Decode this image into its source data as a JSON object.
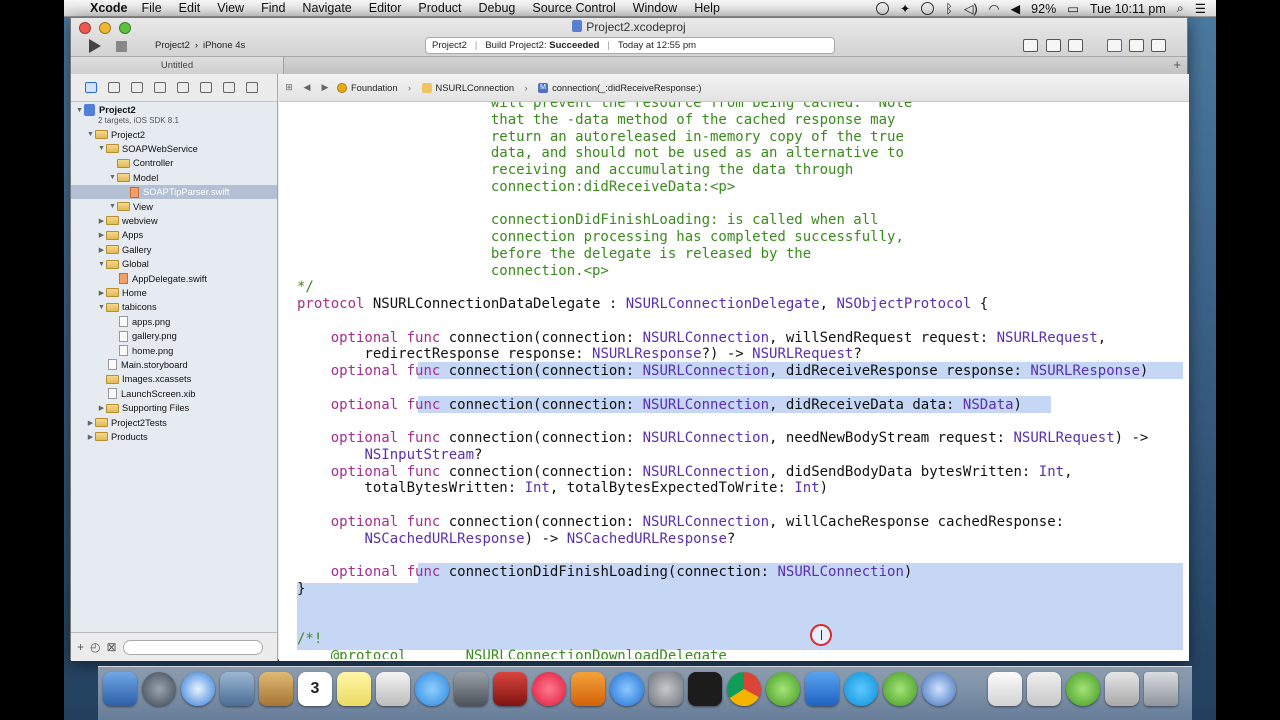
{
  "menubar": {
    "app": "Xcode",
    "items": [
      "File",
      "Edit",
      "View",
      "Find",
      "Navigate",
      "Editor",
      "Product",
      "Debug",
      "Source Control",
      "Window",
      "Help"
    ],
    "battery": "92%",
    "clock": "Tue 10:11 pm"
  },
  "window": {
    "title": "Project2.xcodeproj",
    "scheme": "Project2",
    "device": "iPhone 4s",
    "status": {
      "project": "Project2",
      "build_prefix": "Build Project2:",
      "build_result": "Succeeded",
      "time": "Today at 12:55 pm"
    },
    "tab": "Untitled"
  },
  "navigator": {
    "project_sub": "2 targets, iOS SDK 8.1",
    "items": [
      {
        "label": "Project2",
        "indent": 0,
        "kind": "project",
        "open": true
      },
      {
        "label": "Project2",
        "indent": 1,
        "kind": "folder",
        "open": true
      },
      {
        "label": "SOAPWebService",
        "indent": 2,
        "kind": "folder",
        "open": true
      },
      {
        "label": "Controller",
        "indent": 3,
        "kind": "folder",
        "open": null
      },
      {
        "label": "Model",
        "indent": 3,
        "kind": "folder",
        "open": true
      },
      {
        "label": "SOAPTipParser.swift",
        "indent": 4,
        "kind": "swift",
        "open": null,
        "selected": true
      },
      {
        "label": "View",
        "indent": 3,
        "kind": "folder",
        "open": true
      },
      {
        "label": "webview",
        "indent": 2,
        "kind": "folder",
        "open": false
      },
      {
        "label": "Apps",
        "indent": 2,
        "kind": "folder",
        "open": false
      },
      {
        "label": "Gallery",
        "indent": 2,
        "kind": "folder",
        "open": false
      },
      {
        "label": "Global",
        "indent": 2,
        "kind": "folder",
        "open": true
      },
      {
        "label": "AppDelegate.swift",
        "indent": 3,
        "kind": "swift",
        "open": null
      },
      {
        "label": "Home",
        "indent": 2,
        "kind": "folder",
        "open": false
      },
      {
        "label": "tabicons",
        "indent": 2,
        "kind": "folder",
        "open": true
      },
      {
        "label": "apps.png",
        "indent": 3,
        "kind": "file",
        "open": null
      },
      {
        "label": "gallery.png",
        "indent": 3,
        "kind": "file",
        "open": null
      },
      {
        "label": "home.png",
        "indent": 3,
        "kind": "file",
        "open": null
      },
      {
        "label": "Main.storyboard",
        "indent": 2,
        "kind": "file",
        "open": null
      },
      {
        "label": "Images.xcassets",
        "indent": 2,
        "kind": "folder",
        "open": null
      },
      {
        "label": "LaunchScreen.xib",
        "indent": 2,
        "kind": "file",
        "open": null
      },
      {
        "label": "Supporting Files",
        "indent": 2,
        "kind": "folder",
        "open": false
      },
      {
        "label": "Project2Tests",
        "indent": 1,
        "kind": "folder",
        "open": false
      },
      {
        "label": "Products",
        "indent": 1,
        "kind": "folder",
        "open": false
      }
    ],
    "add_label": "+"
  },
  "jumpbar": {
    "crumbs": [
      "Foundation",
      "NSURLConnection",
      "connection(_:didReceiveResponse:)"
    ]
  },
  "code": [
    [
      [
        "cm",
        "                       will prevent the resource from being cached.  Note"
      ]
    ],
    [
      [
        "cm",
        "                       that the -data method of the cached response may"
      ]
    ],
    [
      [
        "cm",
        "                       return an autoreleased in-memory copy of the true"
      ]
    ],
    [
      [
        "cm",
        "                       data, and should not be used as an alternative to"
      ]
    ],
    [
      [
        "cm",
        "                       receiving and accumulating the data through"
      ]
    ],
    [
      [
        "cm",
        "                       connection:didReceiveData:<p>"
      ]
    ],
    [
      [
        "",
        ""
      ]
    ],
    [
      [
        "cm",
        "                       connectionDidFinishLoading: is called when all"
      ]
    ],
    [
      [
        "cm",
        "                       connection processing has completed successfully,"
      ]
    ],
    [
      [
        "cm",
        "                       before the delegate is released by the"
      ]
    ],
    [
      [
        "cm",
        "                       connection.<p>"
      ]
    ],
    [
      [
        "cm",
        "*/"
      ]
    ],
    [
      [
        "kw",
        "protocol"
      ],
      [
        "",
        " NSURLConnectionDataDelegate : "
      ],
      [
        "ty",
        "NSURLConnectionDelegate"
      ],
      [
        "",
        ", "
      ],
      [
        "ty",
        "NSObjectProtocol"
      ],
      [
        "",
        " {"
      ]
    ],
    [
      [
        "",
        ""
      ]
    ],
    [
      [
        "",
        "    "
      ],
      [
        "kw",
        "optional"
      ],
      [
        "",
        " "
      ],
      [
        "kw",
        "func"
      ],
      [
        "",
        " connection(connection: "
      ],
      [
        "ty",
        "NSURLConnection"
      ],
      [
        "",
        ", willSendRequest request: "
      ],
      [
        "ty",
        "NSURLRequest"
      ],
      [
        "",
        ","
      ]
    ],
    [
      [
        "",
        "        redirectResponse response: "
      ],
      [
        "ty",
        "NSURLResponse"
      ],
      [
        "",
        "?) -> "
      ],
      [
        "ty",
        "NSURLRequest"
      ],
      [
        "",
        "?"
      ]
    ],
    [
      [
        "",
        "    "
      ],
      [
        "kw",
        "optional"
      ],
      [
        "",
        " "
      ],
      [
        "kw",
        "func"
      ],
      [
        "",
        " connection(connection: "
      ],
      [
        "ty",
        "NSURLConnection"
      ],
      [
        "",
        ", didReceiveResponse response: "
      ],
      [
        "ty",
        "NSURLResponse"
      ],
      [
        "",
        ")"
      ]
    ],
    [
      [
        "",
        ""
      ]
    ],
    [
      [
        "",
        "    "
      ],
      [
        "kw",
        "optional"
      ],
      [
        "",
        " "
      ],
      [
        "kw",
        "func"
      ],
      [
        "",
        " connection(connection: "
      ],
      [
        "ty",
        "NSURLConnection"
      ],
      [
        "",
        ", didReceiveData data: "
      ],
      [
        "ty",
        "NSData"
      ],
      [
        "",
        ")"
      ]
    ],
    [
      [
        "",
        ""
      ]
    ],
    [
      [
        "",
        "    "
      ],
      [
        "kw",
        "optional"
      ],
      [
        "",
        " "
      ],
      [
        "kw",
        "func"
      ],
      [
        "",
        " connection(connection: "
      ],
      [
        "ty",
        "NSURLConnection"
      ],
      [
        "",
        ", needNewBodyStream request: "
      ],
      [
        "ty",
        "NSURLRequest"
      ],
      [
        "",
        ") ->"
      ]
    ],
    [
      [
        "",
        "        "
      ],
      [
        "ty",
        "NSInputStream"
      ],
      [
        "",
        "?"
      ]
    ],
    [
      [
        "",
        "    "
      ],
      [
        "kw",
        "optional"
      ],
      [
        "",
        " "
      ],
      [
        "kw",
        "func"
      ],
      [
        "",
        " connection(connection: "
      ],
      [
        "ty",
        "NSURLConnection"
      ],
      [
        "",
        ", didSendBodyData bytesWritten: "
      ],
      [
        "ty",
        "Int"
      ],
      [
        "",
        ","
      ]
    ],
    [
      [
        "",
        "        totalBytesWritten: "
      ],
      [
        "ty",
        "Int"
      ],
      [
        "",
        ", totalBytesExpectedToWrite: "
      ],
      [
        "ty",
        "Int"
      ],
      [
        "",
        ")"
      ]
    ],
    [
      [
        "",
        ""
      ]
    ],
    [
      [
        "",
        "    "
      ],
      [
        "kw",
        "optional"
      ],
      [
        "",
        " "
      ],
      [
        "kw",
        "func"
      ],
      [
        "",
        " connection(connection: "
      ],
      [
        "ty",
        "NSURLConnection"
      ],
      [
        "",
        ", willCacheResponse cachedResponse:"
      ]
    ],
    [
      [
        "",
        "        "
      ],
      [
        "ty",
        "NSCachedURLResponse"
      ],
      [
        "",
        ") -> "
      ],
      [
        "ty",
        "NSCachedURLResponse"
      ],
      [
        "",
        "?"
      ]
    ],
    [
      [
        "",
        ""
      ]
    ],
    [
      [
        "",
        "    "
      ],
      [
        "kw",
        "optional"
      ],
      [
        "",
        " "
      ],
      [
        "kw",
        "func"
      ],
      [
        "",
        " connectionDidFinishLoading(connection: "
      ],
      [
        "ty",
        "NSURLConnection"
      ],
      [
        "",
        ")"
      ]
    ],
    [
      [
        "",
        "}"
      ]
    ],
    [
      [
        "",
        ""
      ]
    ],
    [
      [
        "",
        ""
      ]
    ],
    [
      [
        "cm",
        "/*!"
      ]
    ],
    [
      [
        "cm",
        "    @protocol       NSURLConnectionDownloadDelegate"
      ]
    ]
  ],
  "dock": {
    "calendar_day": "3"
  },
  "colors": {
    "comment": "#3a8a1d",
    "keyword": "#a42d8f",
    "type": "#5a2fae",
    "selection": "#c5d7f5"
  }
}
